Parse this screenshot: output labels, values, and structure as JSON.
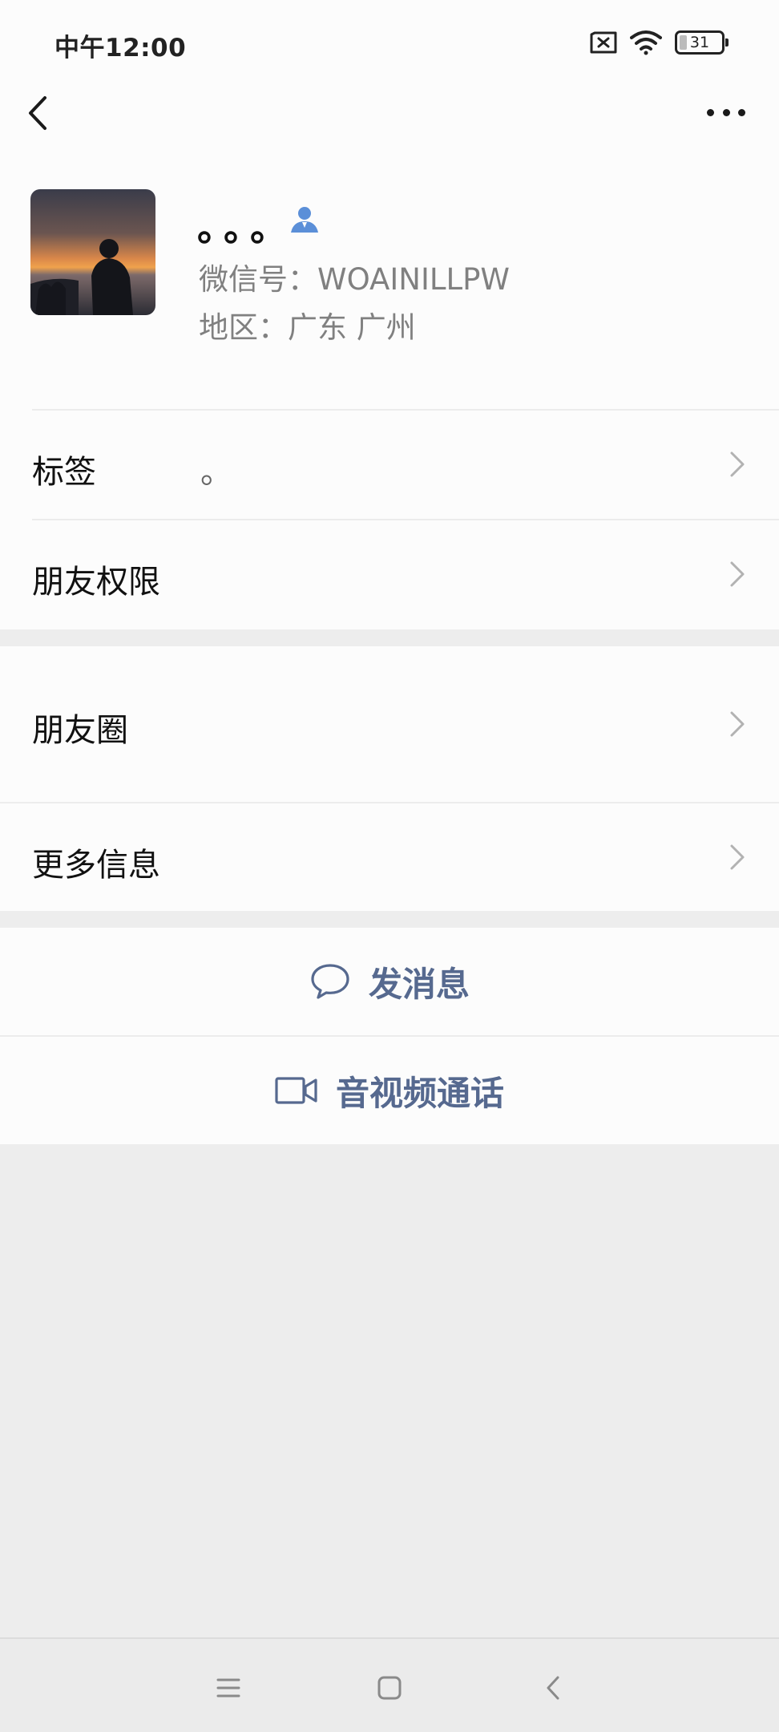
{
  "status_bar": {
    "time": "中午12:00",
    "battery_level": "31",
    "icons": [
      "sim-blocked-icon",
      "wifi-icon",
      "battery-icon"
    ]
  },
  "nav": {
    "back_icon": "back-arrow-icon",
    "more_icon": "more-dots-icon"
  },
  "profile": {
    "nickname": "。。。",
    "wechat_id": "微信号：WOAINILLPW",
    "region": "地区：广东  广州",
    "contact_icon_color": "#5b8fd8"
  },
  "info_rows": [
    {
      "label": "标签",
      "value": "。"
    },
    {
      "label": "朋友权限",
      "value": ""
    }
  ],
  "social_rows": [
    {
      "label": "朋友圈"
    },
    {
      "label": "更多信息"
    }
  ],
  "actions": {
    "message_label": "发消息",
    "call_label": "音视频通话",
    "accent_color": "#56698f"
  },
  "system_nav": {
    "icons": [
      "menu-icon",
      "home-icon",
      "back-icon"
    ]
  }
}
